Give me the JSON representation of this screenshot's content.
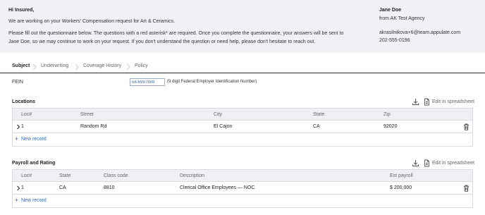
{
  "intro": {
    "greeting": "Hi Insured,",
    "line1": "We are working on your Workers' Compensation request for Art & Ceramics.",
    "line2": "Please fill out the questionnaire below. The questions with a red asterisk* are required. Once you complete the questionnaire, your answers will be sent to",
    "line3": "Jane Doe, so we may continue to work on your request. If you don't understand the question or need help, please don't hesitate to reach out."
  },
  "agent": {
    "name": "Jane Doe",
    "agency": "from AK Test Agency",
    "email": "akrasilnikova+6@team.appulate.com",
    "phone": "202-555-0196"
  },
  "tabs": [
    "Subject",
    "Underwriting",
    "Coverage History",
    "Policy"
  ],
  "fein": {
    "label": "FEIN",
    "value": "58-6997989",
    "hint": "(9 digit Federal Employer Identification Number)"
  },
  "locations": {
    "title": "Locations",
    "edit_label": "Edit in spreadsheet",
    "columns": [
      "Loc#",
      "Street",
      "City",
      "State",
      "Zip"
    ],
    "rows": [
      {
        "loc": "1",
        "street": "Random Rd",
        "city": "El Cajon",
        "state": "CA",
        "zip": "92020"
      }
    ],
    "add_label": "New record"
  },
  "payroll": {
    "title": "Payroll and Rating",
    "edit_label": "Edit in spreadsheet",
    "columns": [
      "Loc#",
      "State",
      "Class code",
      "Description",
      "Est payroll"
    ],
    "rows": [
      {
        "loc": "1",
        "state": "CA",
        "class_code": "8810",
        "description": "Clerical Office Employees — NOC",
        "payroll": "$ 200,000"
      }
    ],
    "add_label": "New record"
  },
  "colors": {
    "intro_bg": "#eff1f5",
    "link": "#2f6db5",
    "grid_header_bg": "#eef0f3"
  }
}
